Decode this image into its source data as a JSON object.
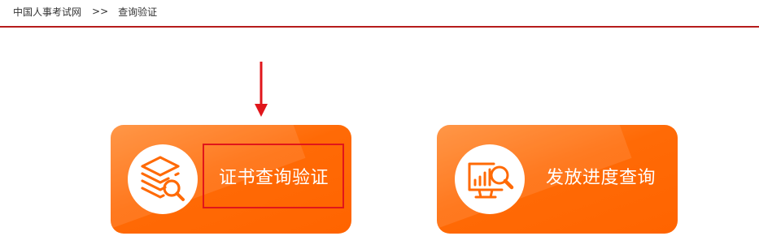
{
  "breadcrumb": {
    "home": "中国人事考试网",
    "separator": ">>",
    "current": "查询验证"
  },
  "cards": [
    {
      "label": "证书查询验证",
      "icon": "certificate-search-icon"
    },
    {
      "label": "发放进度查询",
      "icon": "progress-chart-search-icon"
    }
  ],
  "colors": {
    "accent": "#ff6a06",
    "divider": "#b51c1c",
    "annotation": "#e0161b"
  }
}
